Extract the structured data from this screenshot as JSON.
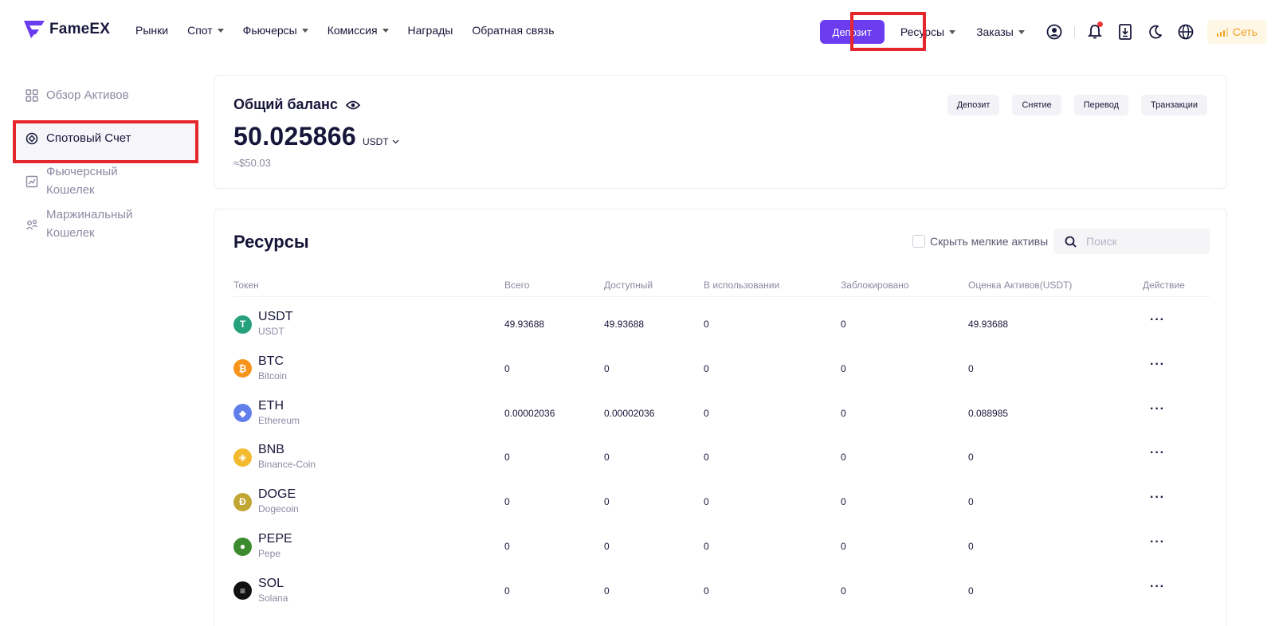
{
  "header": {
    "logo_text": "FameEX",
    "nav": [
      {
        "label": "Рынки",
        "dropdown": false
      },
      {
        "label": "Спот",
        "dropdown": true
      },
      {
        "label": "Фьючерсы",
        "dropdown": true
      },
      {
        "label": "Комиссия",
        "dropdown": true
      },
      {
        "label": "Награды",
        "dropdown": false
      },
      {
        "label": "Обратная связь",
        "dropdown": false
      }
    ],
    "deposit_label": "Депозит",
    "resources_label": "Ресурсы",
    "orders_label": "Заказы",
    "network_label": "Сеть",
    "icons": [
      "user-icon",
      "bell-icon",
      "download-icon",
      "moon-icon",
      "globe-icon"
    ]
  },
  "sidebar": {
    "items": [
      {
        "label": "Обзор Активов",
        "icon": "grid-icon"
      },
      {
        "label": "Спотовый Счет",
        "icon": "target-icon"
      },
      {
        "label": "Фьючерсный Кошелек",
        "icon": "chart-icon"
      },
      {
        "label": "Маржинальный Кошелек",
        "icon": "margin-icon"
      }
    ]
  },
  "balance": {
    "title": "Общий баланс",
    "amount": "50.025866",
    "currency": "USDT",
    "usd": "≈$50.03",
    "actions": [
      "Депозит",
      "Снятие",
      "Перевод",
      "Транзакции"
    ]
  },
  "assets": {
    "title": "Ресурсы",
    "hide_small_label": "Скрыть мелкие активы",
    "search_placeholder": "Поиск",
    "columns": [
      "Токен",
      "Всего",
      "Доступный",
      "В использовании",
      "Заблокировано",
      "Оценка Активов(USDT)",
      "Действие"
    ],
    "rows": [
      {
        "symbol": "USDT",
        "name": "USDT",
        "total": "49.93688",
        "available": "49.93688",
        "in_use": "0",
        "locked": "0",
        "valuation": "49.93688",
        "color": "#26a17b",
        "glyph": "T"
      },
      {
        "symbol": "BTC",
        "name": "Bitcoin",
        "total": "0",
        "available": "0",
        "in_use": "0",
        "locked": "0",
        "valuation": "0",
        "color": "#f7931a",
        "glyph": "₿"
      },
      {
        "symbol": "ETH",
        "name": "Ethereum",
        "total": "0.00002036",
        "available": "0.00002036",
        "in_use": "0",
        "locked": "0",
        "valuation": "0.088985",
        "color": "#627eea",
        "glyph": "◆"
      },
      {
        "symbol": "BNB",
        "name": "Binance-Coin",
        "total": "0",
        "available": "0",
        "in_use": "0",
        "locked": "0",
        "valuation": "0",
        "color": "#f3ba2f",
        "glyph": "◈"
      },
      {
        "symbol": "DOGE",
        "name": "Dogecoin",
        "total": "0",
        "available": "0",
        "in_use": "0",
        "locked": "0",
        "valuation": "0",
        "color": "#c2a633",
        "glyph": "Ð"
      },
      {
        "symbol": "PEPE",
        "name": "Pepe",
        "total": "0",
        "available": "0",
        "in_use": "0",
        "locked": "0",
        "valuation": "0",
        "color": "#3d8b2f",
        "glyph": "●"
      },
      {
        "symbol": "SOL",
        "name": "Solana",
        "total": "0",
        "available": "0",
        "in_use": "0",
        "locked": "0",
        "valuation": "0",
        "color": "#111111",
        "glyph": "≡"
      }
    ]
  },
  "colors": {
    "accent": "#6b3cf0",
    "highlight": "#e6262d",
    "network": "#f0a020"
  }
}
